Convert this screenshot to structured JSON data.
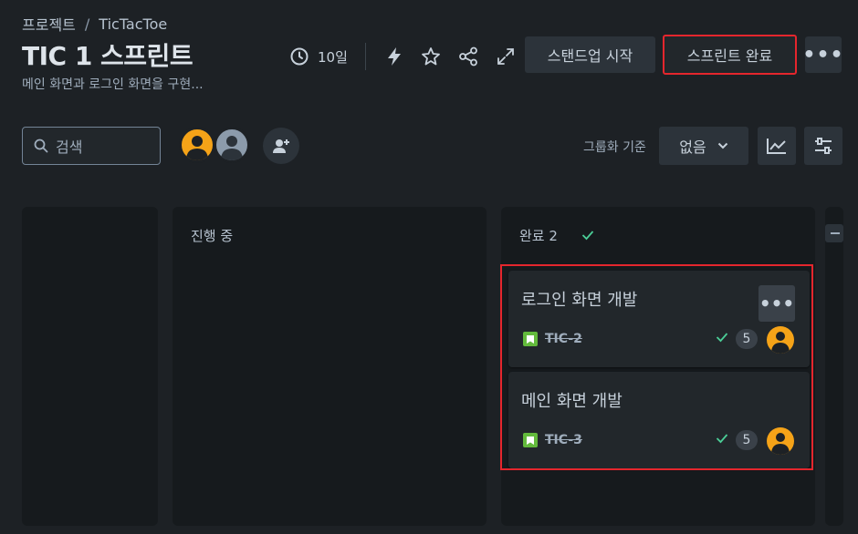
{
  "breadcrumb": {
    "project": "프로젝트",
    "separator": "/",
    "board": "TicTacToe"
  },
  "header": {
    "title": "TIC 1 스프린트",
    "subtitle": "메인 화면과 로그인 화면을 구현...",
    "days_remaining": "10일",
    "standup_label": "스탠드업 시작",
    "complete_sprint_label": "스프린트 완료",
    "more_label": "•••"
  },
  "toolbar": {
    "search_placeholder": "검색",
    "group_by_label": "그룹화 기준",
    "group_by_value": "없음"
  },
  "columns": [
    {
      "title": ""
    },
    {
      "title": "진행 중"
    },
    {
      "title": "완료 2"
    }
  ],
  "cards": [
    {
      "title": "로그인 화면 개발",
      "key": "TIC-2",
      "estimate": "5",
      "more_label": "•••"
    },
    {
      "title": "메인 화면 개발",
      "key": "TIC-3",
      "estimate": "5"
    }
  ],
  "colors": {
    "accent_green": "#63ba3c",
    "avatar_orange": "#f5a318",
    "highlight_red": "#e5262d"
  }
}
